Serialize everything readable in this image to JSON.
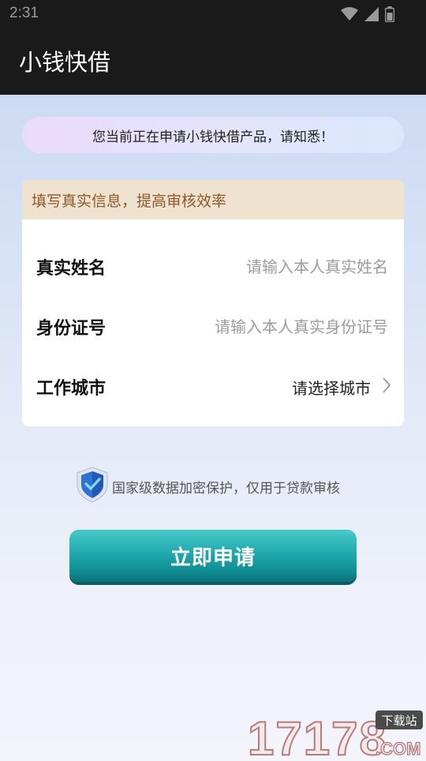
{
  "status_bar": {
    "time": "2:31",
    "icons": [
      "wifi-icon",
      "signal-icon",
      "battery-icon"
    ]
  },
  "app_bar": {
    "title": "小钱快借"
  },
  "notice": {
    "text": "您当前正在申请小钱快借产品，请知悉！"
  },
  "form": {
    "header": "填写真实信息，提高审核效率",
    "fields": [
      {
        "label": "真实姓名",
        "value": "",
        "placeholder": "请输入本人真实姓名"
      },
      {
        "label": "身份证号",
        "value": "",
        "placeholder": "请输入本人真实身份证号"
      },
      {
        "label": "工作城市",
        "value": "请选择城市"
      }
    ]
  },
  "security": {
    "text": "国家级数据加密保护，仅用于贷款审核"
  },
  "apply_button": {
    "label": "立即申请"
  },
  "watermark": {
    "number": "17178",
    "suffix": ".COM",
    "badge": "下载站"
  },
  "colors": {
    "accent": "#20a9ad",
    "header_bg": "#efe3cf",
    "header_text": "#8a5a2b"
  }
}
